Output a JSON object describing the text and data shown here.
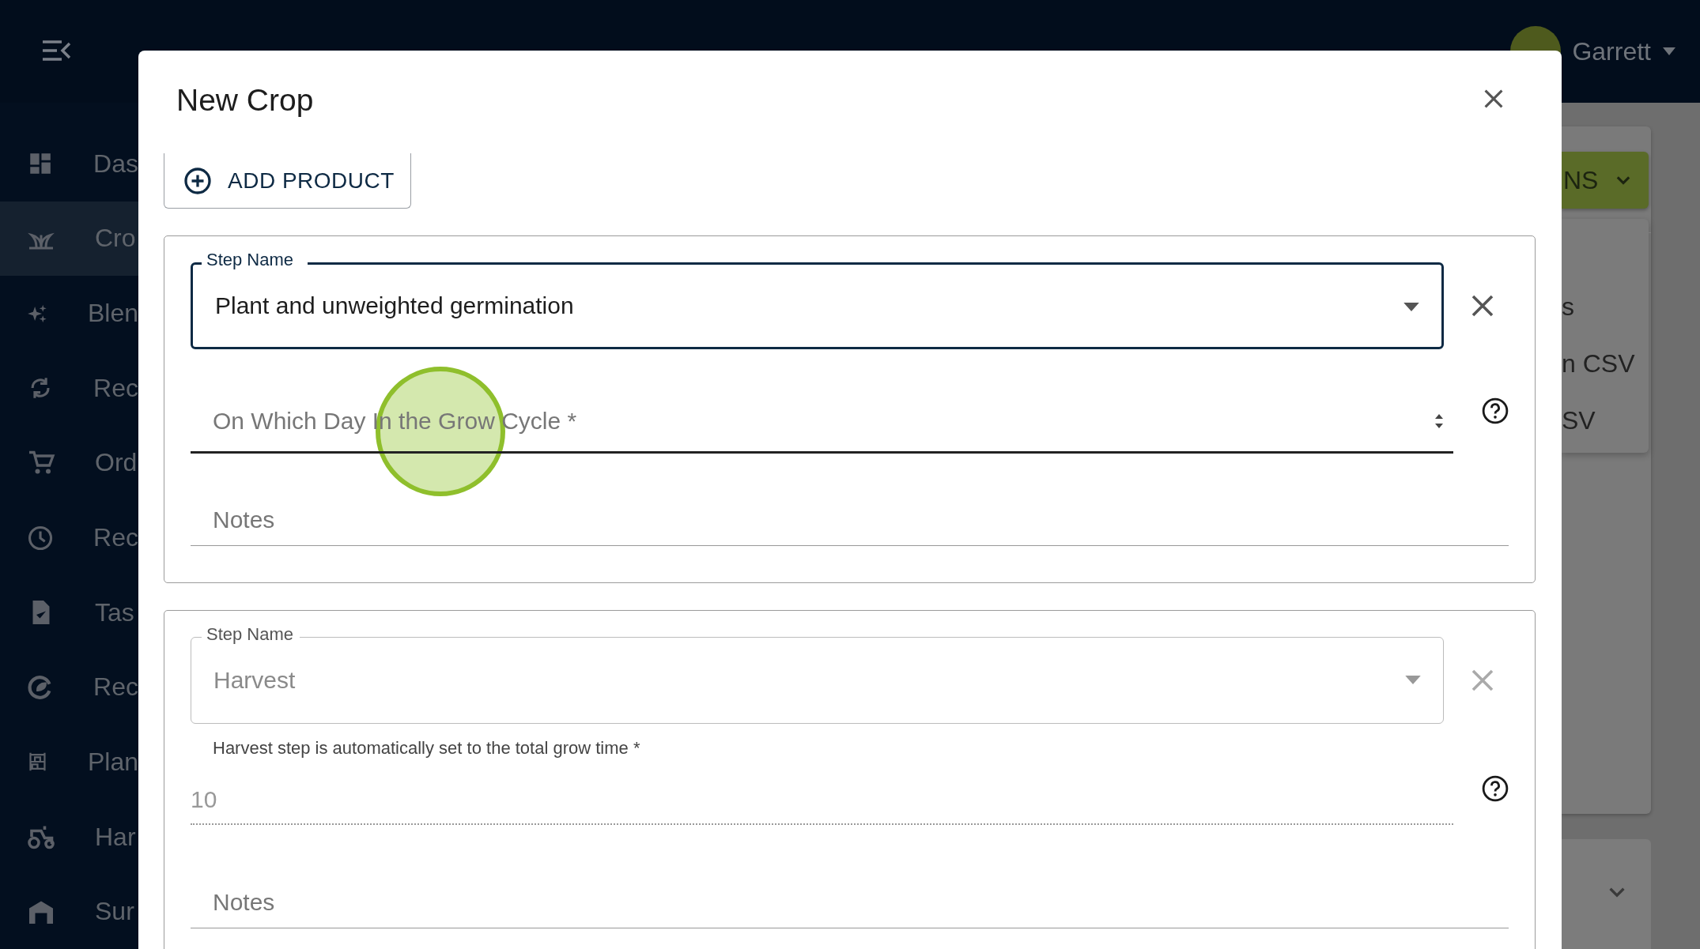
{
  "header": {
    "user_name": "Garrett"
  },
  "sidebar": {
    "items": [
      {
        "label": "Das",
        "selected": false
      },
      {
        "label": "Cro",
        "selected": true
      },
      {
        "label": "Blen",
        "selected": false
      },
      {
        "label": "Rec",
        "selected": false
      },
      {
        "label": "Ord",
        "selected": false
      },
      {
        "label": "Rec",
        "selected": false
      },
      {
        "label": "Tas",
        "selected": false
      },
      {
        "label": "Rec",
        "selected": false
      },
      {
        "label": "Plan",
        "selected": false
      },
      {
        "label": "Har",
        "selected": false
      },
      {
        "label": "Sur",
        "selected": false
      }
    ]
  },
  "background": {
    "actions_button": "NS",
    "menu_items": [
      "s",
      "n CSV",
      "SV"
    ]
  },
  "dialog": {
    "title": "New Crop",
    "add_product": "ADD PRODUCT",
    "steps": [
      {
        "kind": "editable",
        "step_label": "Step Name",
        "value": "Plant and unweighted germination",
        "focused": true,
        "disabled": false,
        "day_placeholder": "On Which Day In the Grow Cycle *",
        "notes_placeholder": "Notes"
      },
      {
        "kind": "harvest",
        "step_label": "Step Name",
        "value": "Harvest",
        "focused": false,
        "disabled": true,
        "day_helper": "Harvest step is automatically set to the total grow time *",
        "day_value": "10",
        "notes_placeholder": "Notes"
      }
    ]
  }
}
